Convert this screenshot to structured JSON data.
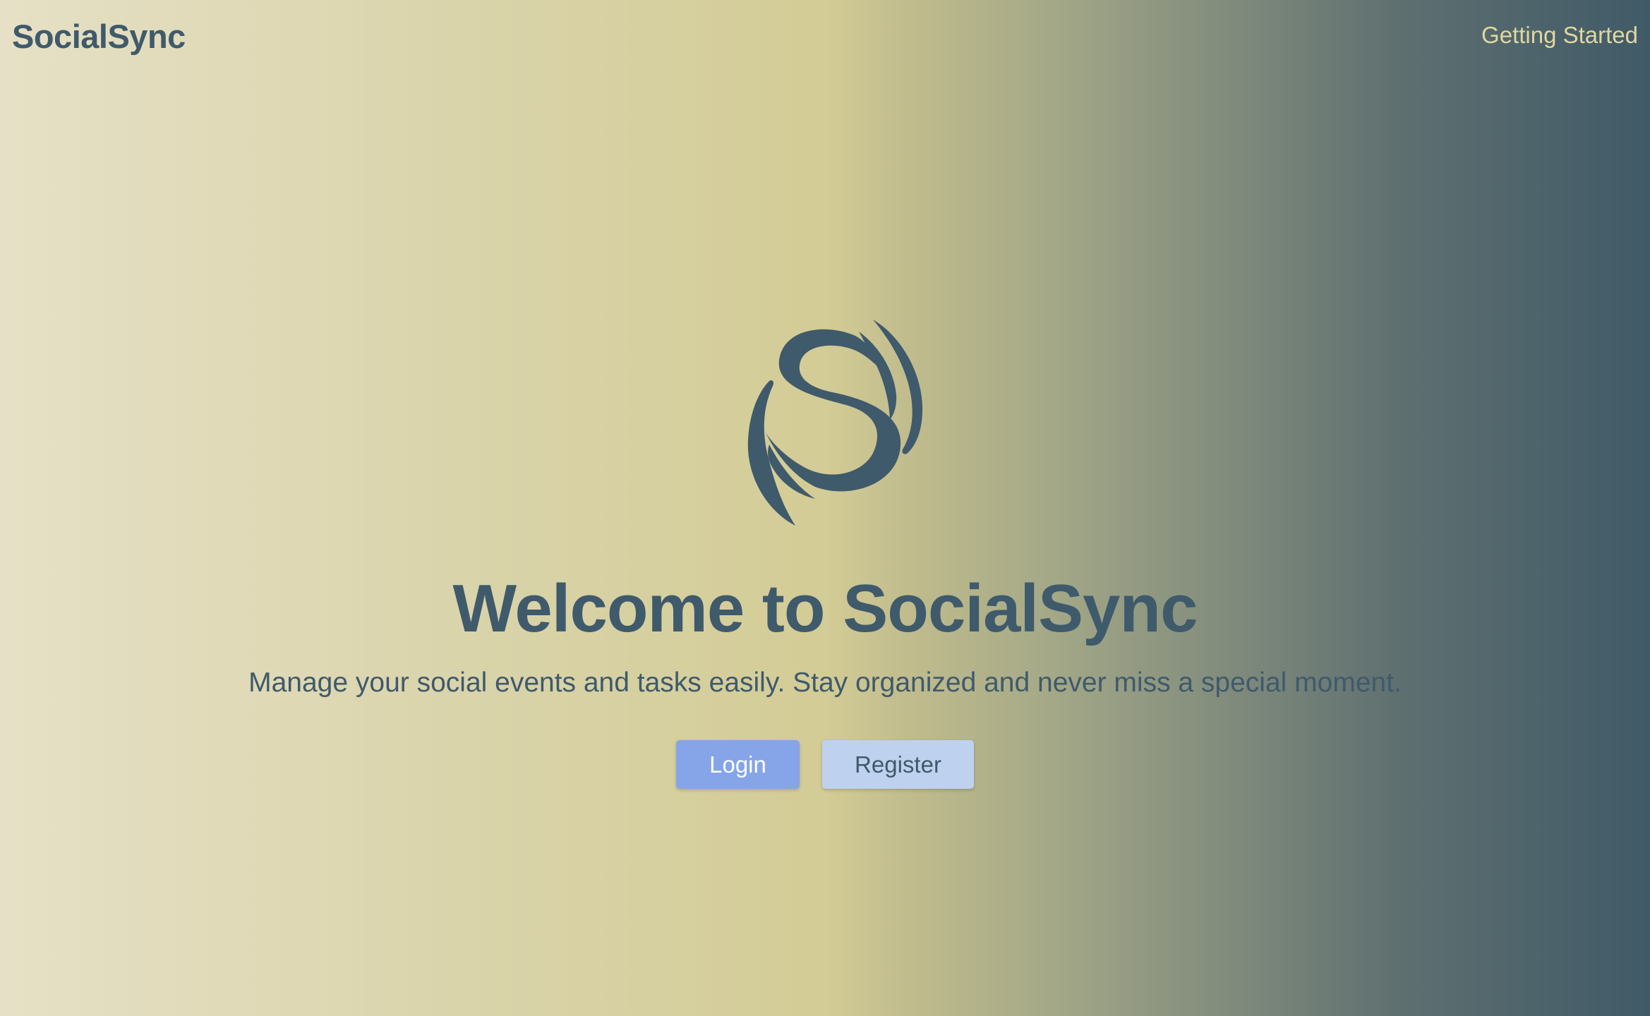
{
  "header": {
    "brand": "SocialSync",
    "nav_link": "Getting Started"
  },
  "hero": {
    "logo_icon": "socialsync-swirl-logo-icon",
    "title": "Welcome to SocialSync",
    "subtitle": "Manage your social events and tasks easily. Stay organized and never miss a special moment."
  },
  "actions": {
    "login_label": "Login",
    "register_label": "Register"
  },
  "colors": {
    "primary_text": "#3f5a6b",
    "nav_link": "#e0d79f",
    "login_button": "#86a5e8",
    "register_button": "#bed1ef"
  }
}
